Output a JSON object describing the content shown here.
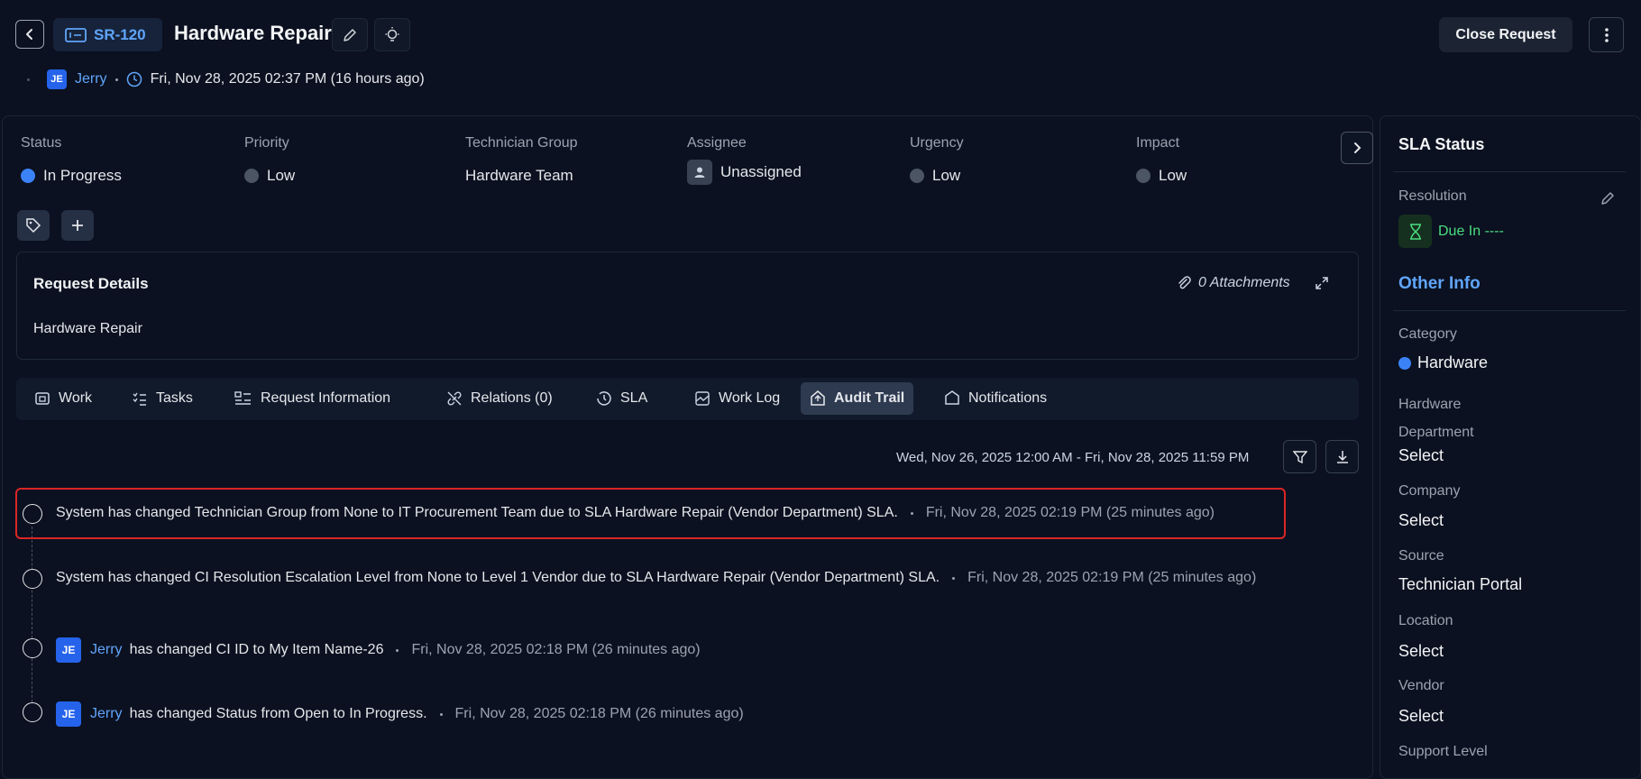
{
  "header": {
    "ticket_id": "SR-120",
    "title": "Hardware Repair",
    "close_label": "Close Request",
    "requester_initials": "JE",
    "requester_name": "Jerry",
    "created_at": "Fri, Nov 28, 2025 02:37 PM (16 hours ago)"
  },
  "fields": [
    {
      "label": "Status",
      "value": "In Progress",
      "color": "#3b82f6"
    },
    {
      "label": "Priority",
      "value": "Low",
      "color": "#4b5563"
    },
    {
      "label": "Technician Group",
      "value": "Hardware Team"
    },
    {
      "label": "Assignee",
      "value": "Unassigned"
    },
    {
      "label": "Urgency",
      "value": "Low",
      "color": "#4b5563"
    },
    {
      "label": "Impact",
      "value": "Low",
      "color": "#4b5563"
    }
  ],
  "request_details": {
    "title": "Request Details",
    "attachments": "0 Attachments",
    "body": "Hardware Repair"
  },
  "tabs": [
    {
      "label": "Work",
      "icon": "work-icon"
    },
    {
      "label": "Tasks",
      "icon": "tasks-icon"
    },
    {
      "label": "Request Information",
      "icon": "request-info-icon"
    },
    {
      "label": "Relations (0)",
      "icon": "relations-icon"
    },
    {
      "label": "SLA",
      "icon": "sla-icon"
    },
    {
      "label": "Work Log",
      "icon": "work-log-icon"
    },
    {
      "label": "Audit Trail",
      "icon": "audit-trail-icon",
      "active": true
    },
    {
      "label": "Notifications",
      "icon": "notifications-icon"
    }
  ],
  "audit": {
    "date_range": "Wed, Nov 26, 2025 12:00 AM - Fri, Nov 28, 2025 11:59 PM",
    "entries": [
      {
        "text": "System has changed Technician Group from None to IT Procurement Team due to SLA Hardware Repair (Vendor Department) SLA.",
        "time": "Fri, Nov 28, 2025 02:19 PM (25 minutes ago)"
      },
      {
        "text": "System has changed CI Resolution Escalation Level from None to Level 1 Vendor due to SLA Hardware Repair (Vendor Department) SLA.",
        "time": "Fri, Nov 28, 2025 02:19 PM (25 minutes ago)"
      },
      {
        "initials": "JE",
        "user": "Jerry",
        "text": "has changed CI ID to My Item Name-26",
        "time": "Fri, Nov 28, 2025 02:18 PM (26 minutes ago)"
      },
      {
        "initials": "JE",
        "user": "Jerry",
        "text": "has changed Status from Open to In Progress.",
        "time": "Fri, Nov 28, 2025 02:18 PM (26 minutes ago)"
      }
    ]
  },
  "sla": {
    "title": "SLA Status",
    "resolution_label": "Resolution",
    "due": "Due In ----"
  },
  "other_info": {
    "title": "Other Info",
    "fields": [
      {
        "label": "Category",
        "value": "Hardware"
      },
      {
        "label": "Hardware Department",
        "value": "Select"
      },
      {
        "label": "Company",
        "value": "Select"
      },
      {
        "label": "Source",
        "value": "Technician Portal"
      },
      {
        "label": "Location",
        "value": "Select"
      },
      {
        "label": "Vendor",
        "value": "Select"
      },
      {
        "label": "Support Level",
        "value": ""
      }
    ]
  }
}
